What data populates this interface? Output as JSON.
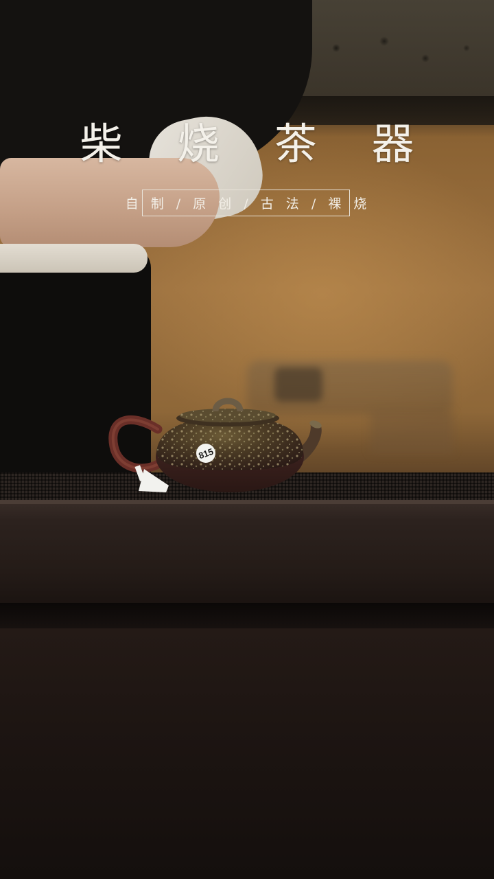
{
  "scene": {
    "title": "柴 烧 茶 器",
    "subtitle": "自 制 / 原 创 / 古 法 / 裸 烧",
    "teapot_tag_number": "815",
    "colors": {
      "title_text": "#f4f1ea",
      "frame_border": "#e9e4da",
      "wall": "#9d7240",
      "tray": "#2d2622",
      "table": "#1d1512"
    }
  }
}
